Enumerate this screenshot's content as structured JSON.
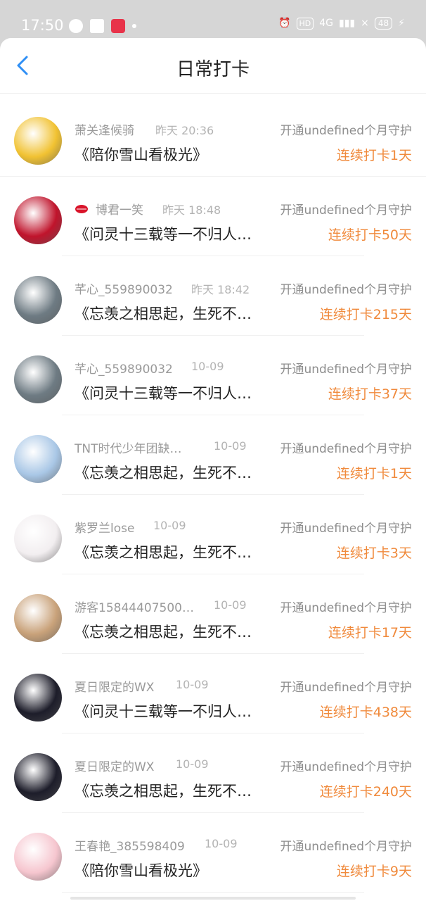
{
  "status_bar": {
    "time": "17:50",
    "hd_label": "HD",
    "network": "4G",
    "battery": "48"
  },
  "header": {
    "title": "日常打卡",
    "back_icon": "chevron-left-icon"
  },
  "items": [
    {
      "name": "萧关逢候骑",
      "time": "昨天 20:36",
      "guard": "开通undefined个月守护",
      "book": "《陪你雪山看极光》",
      "streak": "连续打卡1天",
      "avatar_color": "#f1c232"
    },
    {
      "name": "博君一笑",
      "time": "昨天 18:48",
      "guard": "开通undefined个月守护",
      "book": "《问灵十三载等一不归人…",
      "streak": "连续打卡50天",
      "avatar_color": "#c0142c"
    },
    {
      "name": "芊心_559890032",
      "time": "昨天 18:42",
      "guard": "开通undefined个月守护",
      "book": "《忘羡之相思起，生死不…",
      "streak": "连续打卡215天",
      "avatar_color": "#6e7b83"
    },
    {
      "name": "芊心_559890032",
      "time": "10-09",
      "guard": "开通undefined个月守护",
      "book": "《问灵十三载等一不归人…",
      "streak": "连续打卡37天",
      "avatar_color": "#6e7b83"
    },
    {
      "name": "TNT时代少年团缺…",
      "time": "10-09",
      "guard": "开通undefined个月守护",
      "book": "《忘羡之相思起，生死不…",
      "streak": "连续打卡1天",
      "avatar_color": "#a9c7e6"
    },
    {
      "name": "紫罗兰lose",
      "time": "10-09",
      "guard": "开通undefined个月守护",
      "book": "《忘羡之相思起，生死不…",
      "streak": "连续打卡3天",
      "avatar_color": "#f2eef0"
    },
    {
      "name": "游客15844407500…",
      "time": "10-09",
      "guard": "开通undefined个月守护",
      "book": "《忘羡之相思起，生死不…",
      "streak": "连续打卡17天",
      "avatar_color": "#c9a27a"
    },
    {
      "name": "夏日限定的WX",
      "time": "10-09",
      "guard": "开通undefined个月守护",
      "book": "《问灵十三载等一不归人…",
      "streak": "连续打卡438天",
      "avatar_color": "#1d1d2a"
    },
    {
      "name": "夏日限定的WX",
      "time": "10-09",
      "guard": "开通undefined个月守护",
      "book": "《忘羡之相思起，生死不…",
      "streak": "连续打卡240天",
      "avatar_color": "#1d1d2a"
    },
    {
      "name": "王春艳_385598409",
      "time": "10-09",
      "guard": "开通undefined个月守护",
      "book": "《陪你雪山看极光》",
      "streak": "连续打卡9天",
      "avatar_color": "#f6c6cf"
    }
  ],
  "colors": {
    "accent": "#2f8ff5",
    "streak": "#f08a3c"
  }
}
